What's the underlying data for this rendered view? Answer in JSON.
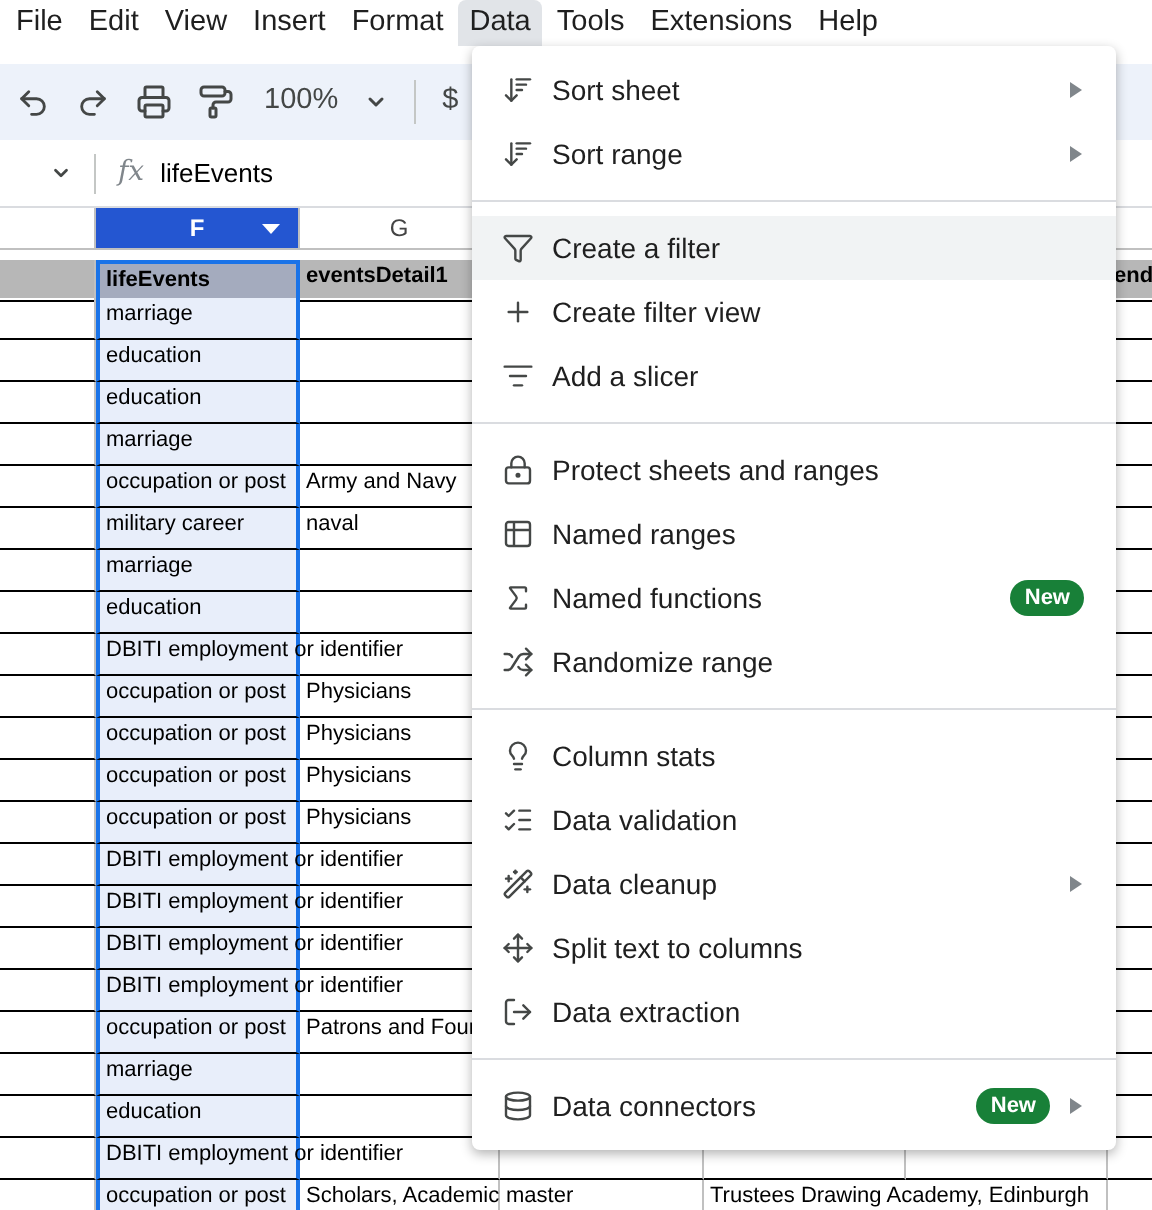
{
  "menu_bar": [
    {
      "label": "File",
      "selected": false
    },
    {
      "label": "Edit",
      "selected": false
    },
    {
      "label": "View",
      "selected": false
    },
    {
      "label": "Insert",
      "selected": false
    },
    {
      "label": "Format",
      "selected": false
    },
    {
      "label": "Data",
      "selected": true
    },
    {
      "label": "Tools",
      "selected": false
    },
    {
      "label": "Extensions",
      "selected": false
    },
    {
      "label": "Help",
      "selected": false
    }
  ],
  "toolbar": {
    "zoom": "100%",
    "currency": "$"
  },
  "formula_bar": {
    "fx_label": "fx",
    "value": "lifeEvents"
  },
  "column_headers": [
    {
      "label": "F",
      "selected": true
    },
    {
      "label": "G",
      "selected": false
    }
  ],
  "header_row": {
    "life_events": "lifeEvents",
    "details": "eventsDetail1",
    "column_k": "end"
  },
  "rows": [
    {
      "life_events": "marriage"
    },
    {
      "life_events": "education"
    },
    {
      "life_events": "education"
    },
    {
      "life_events": "marriage"
    },
    {
      "life_events": "occupation or post",
      "details": "Army and Navy"
    },
    {
      "life_events": "military career",
      "details": "naval"
    },
    {
      "life_events": "marriage"
    },
    {
      "life_events": "education"
    },
    {
      "life_events": "DBITI employment or identifier"
    },
    {
      "life_events": "occupation or post",
      "details": "Physicians"
    },
    {
      "life_events": "occupation or post",
      "details": "Physicians"
    },
    {
      "life_events": "occupation or post",
      "details": "Physicians"
    },
    {
      "life_events": "occupation or post",
      "details": "Physicians"
    },
    {
      "life_events": "DBITI employment or identifier"
    },
    {
      "life_events": "DBITI employment or identifier"
    },
    {
      "life_events": "DBITI employment or identifier"
    },
    {
      "life_events": "DBITI employment or identifier"
    },
    {
      "life_events": "occupation or post",
      "details": "Patrons and Four"
    },
    {
      "life_events": "marriage"
    },
    {
      "life_events": "education"
    },
    {
      "life_events": "DBITI employment or identifier"
    },
    {
      "life_events": "occupation or post",
      "details": "Scholars, Academic",
      "column_h": "master",
      "column_i": "Trustees Drawing Academy, Edinburgh"
    }
  ],
  "data_menu": [
    [
      {
        "kind": "sort",
        "label": "Sort sheet",
        "submenu": true,
        "highlighted": false
      },
      {
        "kind": "sort",
        "label": "Sort range",
        "submenu": true,
        "highlighted": false
      }
    ],
    [
      {
        "kind": "filter",
        "label": "Create a filter",
        "submenu": false,
        "highlighted": true
      },
      {
        "kind": "plus",
        "label": "Create filter view",
        "submenu": false,
        "highlighted": false
      },
      {
        "kind": "slicer",
        "label": "Add a slicer",
        "submenu": false,
        "highlighted": false
      }
    ],
    [
      {
        "kind": "lock",
        "label": "Protect sheets and ranges",
        "submenu": false,
        "highlighted": false
      },
      {
        "kind": "table",
        "label": "Named ranges",
        "submenu": false,
        "highlighted": false
      },
      {
        "kind": "sigma",
        "label": "Named functions",
        "badge": "New",
        "submenu": false,
        "highlighted": false
      },
      {
        "kind": "shuffle",
        "label": "Randomize range",
        "submenu": false,
        "highlighted": false
      }
    ],
    [
      {
        "kind": "bulb",
        "label": "Column stats",
        "submenu": false,
        "highlighted": false
      },
      {
        "kind": "validate",
        "label": "Data validation",
        "submenu": false,
        "highlighted": false
      },
      {
        "kind": "wand",
        "label": "Data cleanup",
        "submenu": true,
        "highlighted": false
      },
      {
        "kind": "split",
        "label": "Split text to columns",
        "submenu": false,
        "highlighted": false
      },
      {
        "kind": "extract",
        "label": "Data extraction",
        "submenu": false,
        "highlighted": false
      }
    ],
    [
      {
        "kind": "database",
        "label": "Data connectors",
        "badge": "New",
        "submenu": true,
        "highlighted": false
      }
    ]
  ]
}
